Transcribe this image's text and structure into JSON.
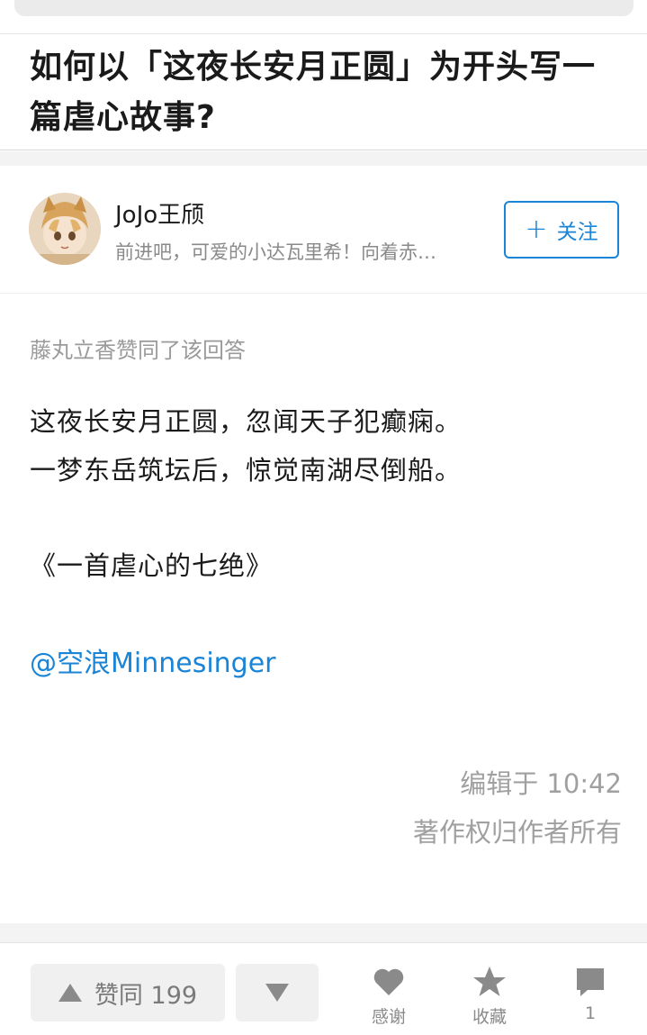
{
  "question": {
    "title": "如何以「这夜长安月正圆」为开头写一篇虐心故事?"
  },
  "author": {
    "name": "JoJo王颀",
    "bio": "前进吧，可爱的小达瓦里希！向着赤…",
    "follow_label": "关注"
  },
  "answer": {
    "upvoter_note": "藤丸立香赞同了该回答",
    "poem_lines": [
      "这夜长安月正圆，忽闻天子犯癫痫。",
      "一梦东岳筑坛后，惊觉南湖尽倒船。"
    ],
    "poem_title": "《一首虐心的七绝》",
    "mention": "@空浪Minnesinger",
    "edit_time": "编辑于 10:42",
    "copyright": "著作权归作者所有"
  },
  "actions": {
    "upvote_label": "赞同 199",
    "thanks_label": "感谢",
    "collect_label": "收藏",
    "comment_count": "1"
  },
  "colors": {
    "accent": "#1a84d6",
    "muted_text": "#9a9a9a",
    "icon_gray": "#8a8a8a"
  },
  "icons": [
    "plus-icon",
    "upvote-arrow-icon",
    "downvote-arrow-icon",
    "heart-icon",
    "star-icon",
    "comment-bubble-icon"
  ]
}
